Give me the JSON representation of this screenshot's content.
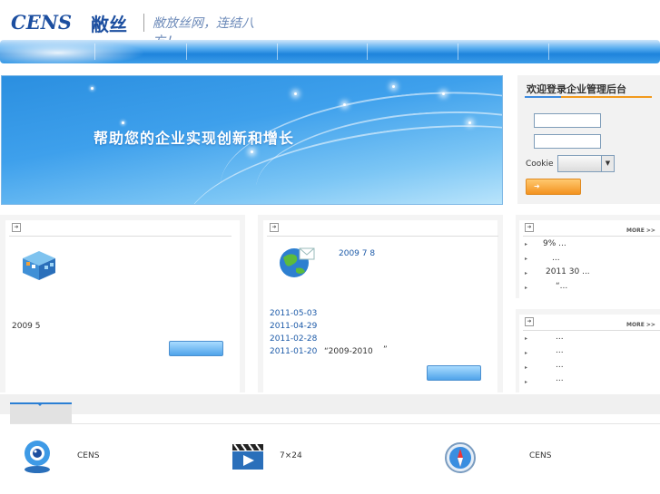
{
  "header": {
    "logo_text": "CENS",
    "logo_cn": "敝丝",
    "slogan": "敝放丝网，连结八方！"
  },
  "banner": {
    "headline": "帮助您的企业实现创新和增长"
  },
  "login": {
    "title": "欢迎登录企业管理后台",
    "cookie_label": "Cookie",
    "cookie_value": ""
  },
  "panel_left": {
    "text": "2009 5"
  },
  "panel_news": {
    "headline": "2009 7 8",
    "items": [
      {
        "date": "2011-05-03",
        "text": ""
      },
      {
        "date": "2011-04-29",
        "text": ""
      },
      {
        "date": "2011-02-28",
        "text": ""
      },
      {
        "date": "2011-01-20",
        "text": "“2009-2010",
        "suffix": "”"
      }
    ]
  },
  "panel_right_top": {
    "more": "MORE >>",
    "items": [
      "9%      ...",
      "...",
      "2011 30 ...",
      "“..."
    ]
  },
  "panel_right_bottom": {
    "more": "MORE >>",
    "items": [
      "...",
      "...",
      "...",
      "..."
    ]
  },
  "services": [
    {
      "icon": "webcam-icon",
      "label": "CENS"
    },
    {
      "icon": "video-clapper-icon",
      "label": "7×24"
    },
    {
      "icon": "compass-icon",
      "label": "CENS"
    }
  ],
  "colors": {
    "brand": "#1d4fa0",
    "nav_blue": "#1e84dc",
    "accent_orange": "#f39220",
    "date_blue": "#1c5aa8"
  }
}
